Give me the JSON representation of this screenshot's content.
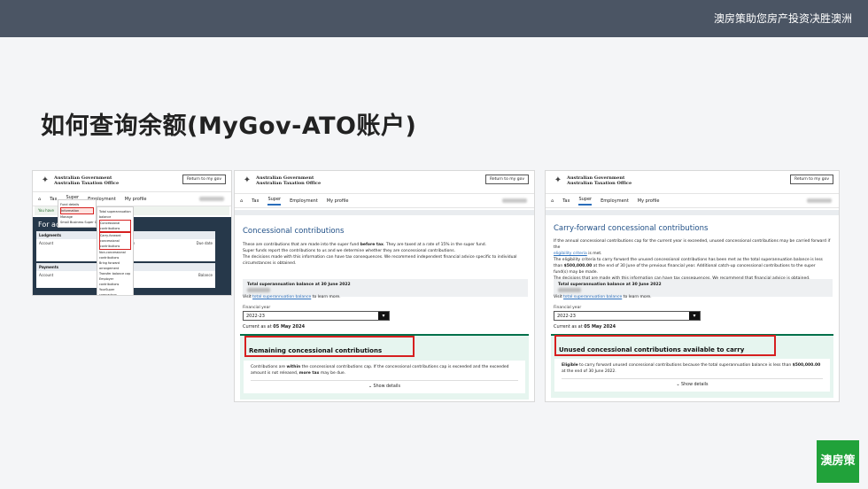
{
  "header": {
    "tagline": "澳房策助您房产投资决胜澳洲"
  },
  "slide": {
    "title": "如何查询余额(MyGov-ATO账户)"
  },
  "brand": {
    "logo_text": "澳房策"
  },
  "gov": {
    "line1": "Australian Government",
    "line2": "Australian Taxation Office",
    "return_btn": "Return to my gov"
  },
  "nav": {
    "home_icon": "home-icon",
    "tax": "Tax",
    "super": "Super",
    "employment": "Employment",
    "my_profile": "My profile"
  },
  "shot1": {
    "banner": "You have",
    "for_action": "For act",
    "lodgments_head": "Lodgments",
    "col_account": "Account",
    "col_description": "Description",
    "col_due_date": "Due date",
    "payments_head": "Payments",
    "pay_account": "Account",
    "pay_balance": "Balance",
    "super_menu": [
      "Fund details",
      "Information",
      "Manage",
      "Small Business Super Clearing House"
    ],
    "info_menu": [
      "Total superannuation balance",
      "Concessional contributions",
      "Carry-forward concessional contributions",
      "Non-concessional contributions",
      "Bring forward arrangement",
      "Transfer balance cap",
      "Employer contributions",
      "YourSuper comparison"
    ]
  },
  "shot2": {
    "heading": "Concessional contributions",
    "p1_a": "These are contributions that are made into the super fund ",
    "p1_b": "before tax",
    "p1_c": ". They are taxed at a rate of 15% in the super fund.",
    "p2": "Super funds report the contributions to us and we determine whether they are concessional contributions.",
    "p3": "The decisions made with this information can have tax consequences. We recommend independent financial advice specific to individual circumstances is obtained.",
    "bal_label": "Total superannuation balance at 30 June 2022",
    "visit": "Visit ",
    "visit_link": "total superannuation balance",
    "visit_end": " to learn more.",
    "fy_label": "Financial year",
    "fy_value": "2022-23",
    "current_prefix": "Current as at ",
    "current_date": "05 May 2024",
    "box_title": "Remaining concessional contributions",
    "pill": "Cap available",
    "card_a": "Contributions are ",
    "card_b": "within",
    "card_c": " the concessional contributions cap. If the concessional contributions cap is exceeded and the exceeded amount is not released, ",
    "card_d": "more tax",
    "card_e": " may be due.",
    "show": "Show details"
  },
  "shot3": {
    "heading": "Carry-forward concessional contributions",
    "p1": "If the annual concessional contributions cap for the current year is exceeded, unused concessional contributions may be carried forward if the",
    "p1_link": "eligibility criteria",
    "p1_end": " is met.",
    "p2_a": "The eligibility criteria to carry forward the unused concessional contributions has been met as the total superannuation balance is less than ",
    "p2_b": "$500,000.00",
    "p2_c": " at the end of 30 June of the previous financial year. Additional catch-up concessional contributions to the super fund(s) may be made.",
    "p3": "The decisions that are made with this information can have tax consequences. We recommend that financial advice is obtained.",
    "bal_label": "Total superannuation balance at 30 June 2022",
    "visit": "Visit ",
    "visit_link": "total superannuation balance",
    "visit_end": " to learn more.",
    "fy_label": "Financial year",
    "fy_value": "2022-23",
    "current_prefix": "Current as at ",
    "current_date": "05 May 2024",
    "box_title": "Unused concessional contributions available to carry forward",
    "pill": "Eligible",
    "card_a": "Eligible",
    "card_b": " to carry forward unused concessional contributions because the total superannuation balance is less than ",
    "card_c": "$500,000.00",
    "card_d": " at the end of 30 June 2022.",
    "show": "Show details"
  }
}
